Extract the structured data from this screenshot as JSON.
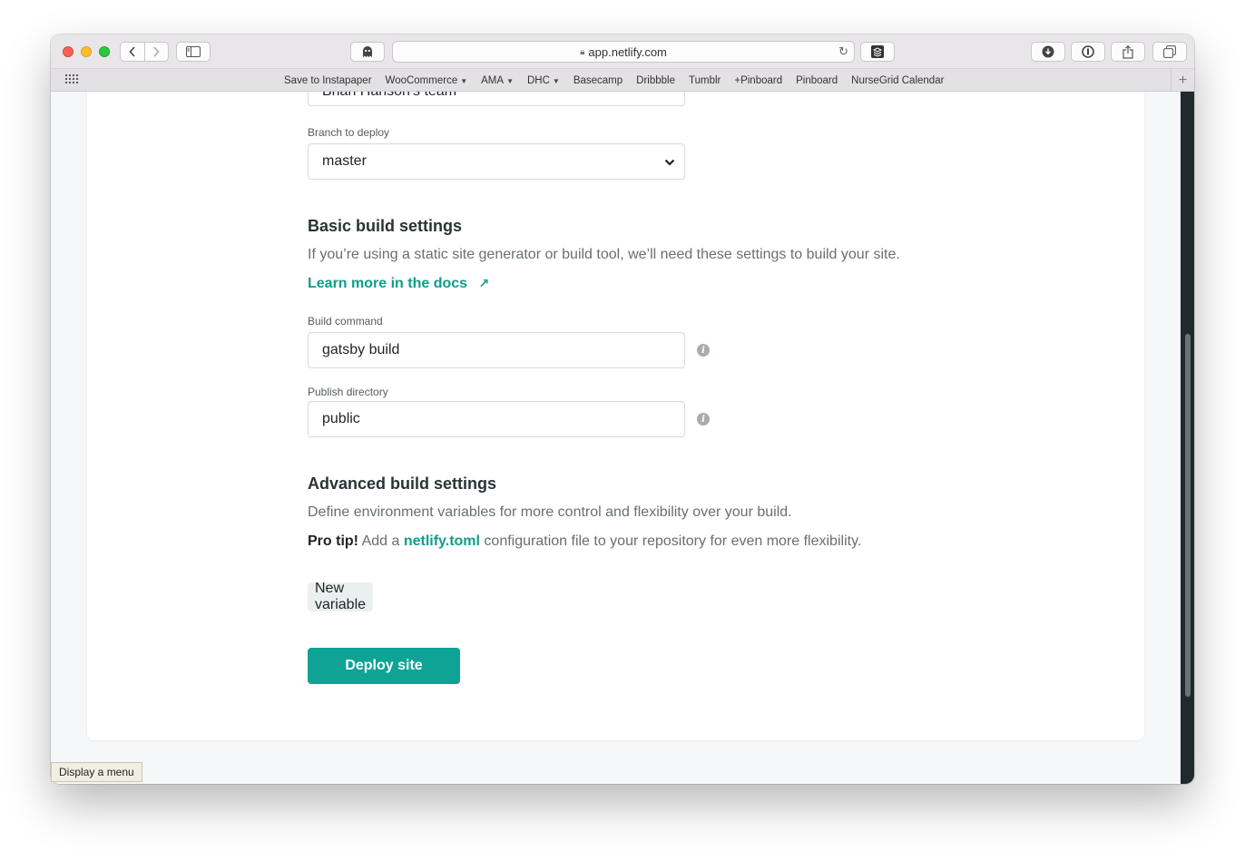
{
  "browser": {
    "url": "app.netlify.com",
    "bookmarks": [
      {
        "label": "Save to Instapaper",
        "chevron": false
      },
      {
        "label": "WooCommerce",
        "chevron": true
      },
      {
        "label": "AMA",
        "chevron": true
      },
      {
        "label": "DHC",
        "chevron": true
      },
      {
        "label": "Basecamp",
        "chevron": false
      },
      {
        "label": "Dribbble",
        "chevron": false
      },
      {
        "label": "Tumblr",
        "chevron": false
      },
      {
        "label": "+Pinboard",
        "chevron": false
      },
      {
        "label": "Pinboard",
        "chevron": false
      },
      {
        "label": "NurseGrid Calendar",
        "chevron": false
      }
    ]
  },
  "form": {
    "owner_value_cut": "Brian Hanson's team",
    "branch_label": "Branch to deploy",
    "branch_value": "master",
    "basic_heading": "Basic build settings",
    "basic_desc": "If you’re using a static site generator or build tool, we’ll need these settings to build your site.",
    "learn_more": "Learn more in the docs",
    "learn_more_arrow": "↗",
    "build_cmd_label": "Build command",
    "build_cmd_value": "gatsby build",
    "publish_label": "Publish directory",
    "publish_value": "public",
    "advanced_heading": "Advanced build settings",
    "advanced_desc": "Define environment variables for more control and flexibility over your build.",
    "pro_tip_bold": "Pro tip!",
    "pro_tip_pre": " Add a ",
    "pro_tip_link": "netlify.toml",
    "pro_tip_post": " configuration file to your repository for even more flexibility.",
    "new_variable": "New variable",
    "deploy": "Deploy site"
  },
  "tooltip": "Display a menu",
  "colors": {
    "accent": "#0fa396",
    "link": "#0f9d8b",
    "scrollbar": "#1f2a2e"
  }
}
